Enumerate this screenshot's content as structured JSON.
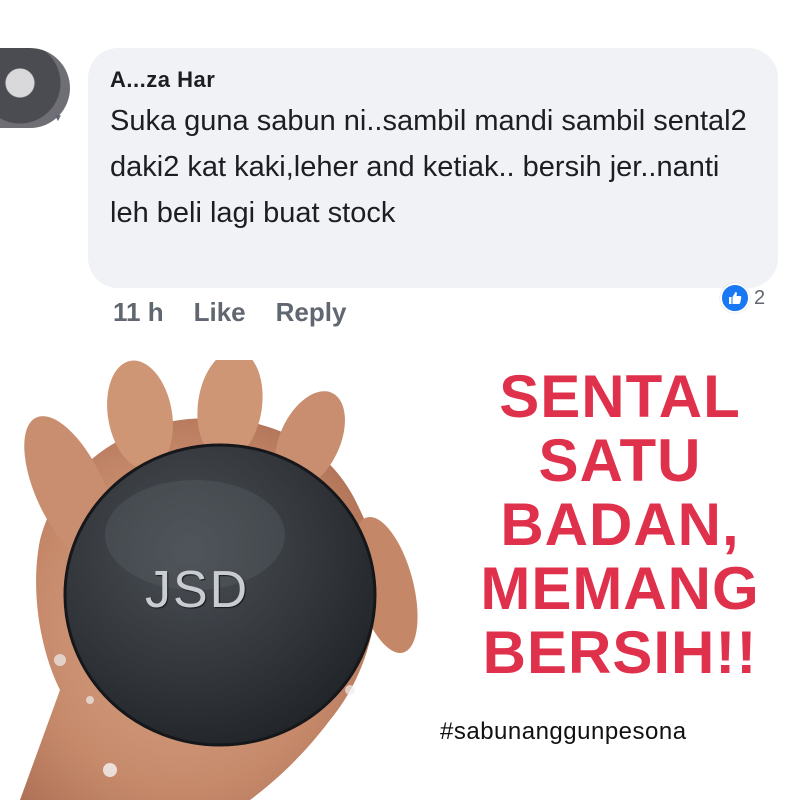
{
  "comment": {
    "author_name": "A...za Har",
    "text": "Suka guna sabun ni..sambil mandi sambil sental2 daki2 kat kaki,leher and ketiak.. bersih jer..nanti leh beli lagi buat stock",
    "timestamp": "11 h",
    "like_label": "Like",
    "reply_label": "Reply",
    "reaction_count": "2",
    "reaction_icon": "thumbs-up-icon",
    "colors": {
      "bubble": "#f0f2f5",
      "like_blue": "#1877f2",
      "meta_gray": "#606770"
    }
  },
  "ad": {
    "soap_stamp": "JSD",
    "headline_lines": [
      "SENTAL",
      "SATU",
      "BADAN,",
      "MEMANG",
      "BERSIH!!"
    ],
    "hashtag": "#sabunanggunpesona",
    "colors": {
      "headline": "#e0314c",
      "soap": "#2f3338"
    }
  }
}
